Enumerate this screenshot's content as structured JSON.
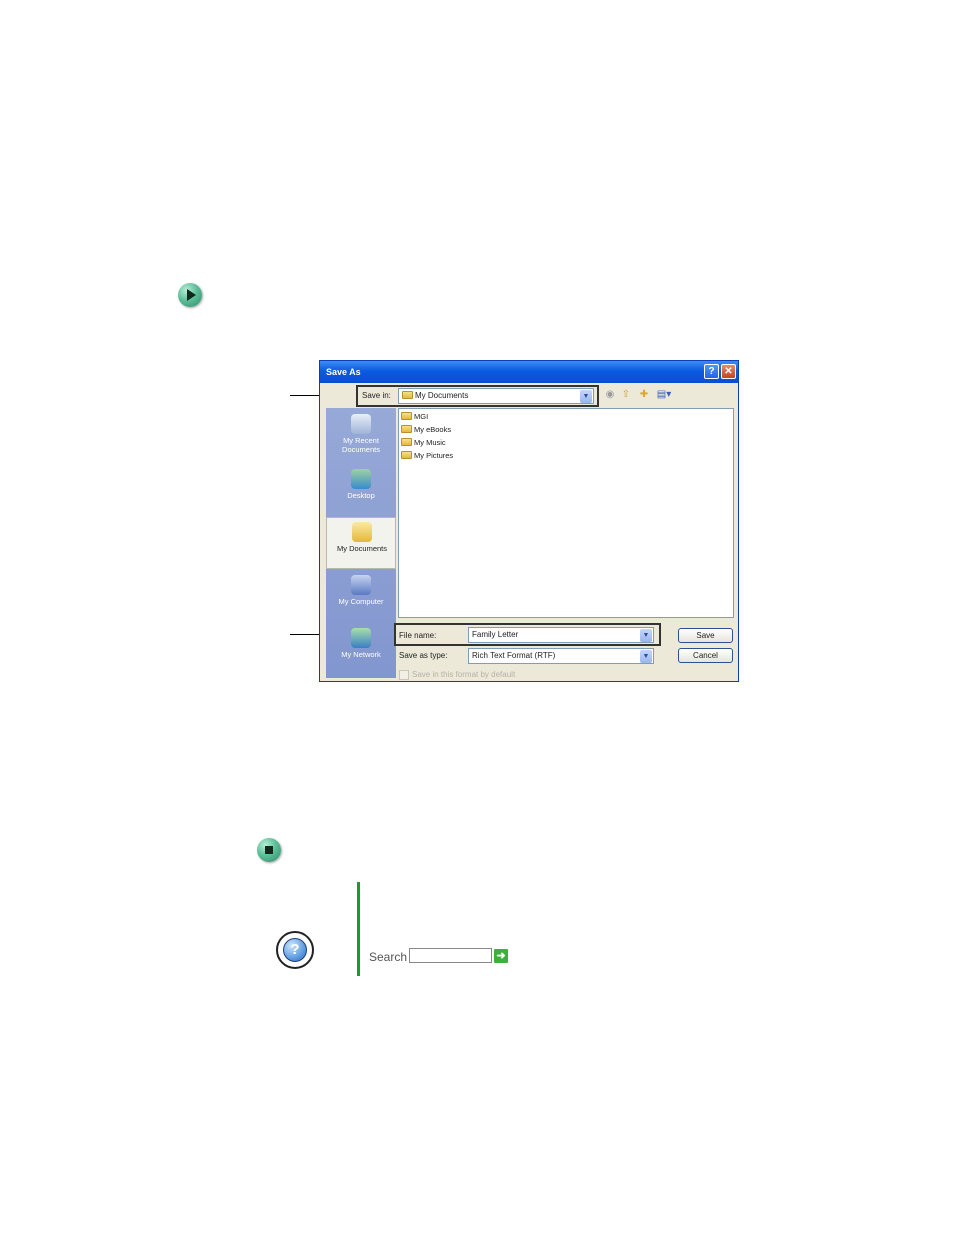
{
  "dialog": {
    "title": "Save As",
    "help_button": "?",
    "close_button": "✕",
    "save_in_label": "Save in:",
    "save_in_value": "My Documents",
    "places": [
      {
        "label": "My Recent Documents",
        "icon": "recent-documents-icon"
      },
      {
        "label": "Desktop",
        "icon": "desktop-icon"
      },
      {
        "label": "My Documents",
        "icon": "my-documents-icon"
      },
      {
        "label": "My Computer",
        "icon": "my-computer-icon"
      },
      {
        "label": "My Network",
        "icon": "my-network-icon"
      }
    ],
    "files": [
      "MGI",
      "My eBooks",
      "My Music",
      "My Pictures"
    ],
    "file_name_label": "File name:",
    "file_name_value": "Family Letter",
    "save_as_type_label": "Save as type:",
    "save_as_type_value": "Rich Text Format (RTF)",
    "save_button": "Save",
    "cancel_button": "Cancel",
    "default_format_checkbox": "Save in this format by default"
  },
  "bottom": {
    "search_label": "Search"
  },
  "colors": {
    "accent_green": "#14a01c",
    "title_bar_blue": "#0b5be0"
  }
}
